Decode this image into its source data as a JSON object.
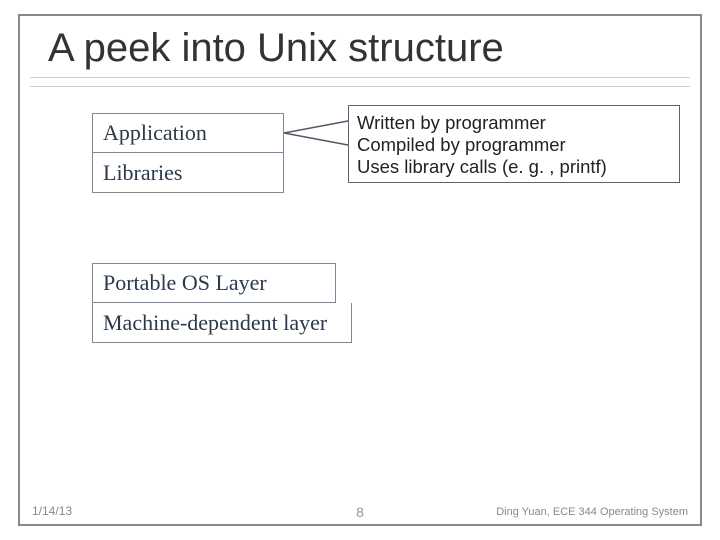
{
  "title": "A peek into Unix structure",
  "stack": {
    "application": "Application",
    "libraries": "Libraries",
    "portable_os": "Portable OS Layer",
    "machine_dep": "Machine-dependent layer"
  },
  "callout": {
    "line1": "Written by programmer",
    "line2": "Compiled by programmer",
    "line3": "Uses library calls (e. g. , printf)"
  },
  "footer": {
    "date": "1/14/13",
    "page": "8",
    "credit": "Ding Yuan, ECE 344 Operating System"
  }
}
